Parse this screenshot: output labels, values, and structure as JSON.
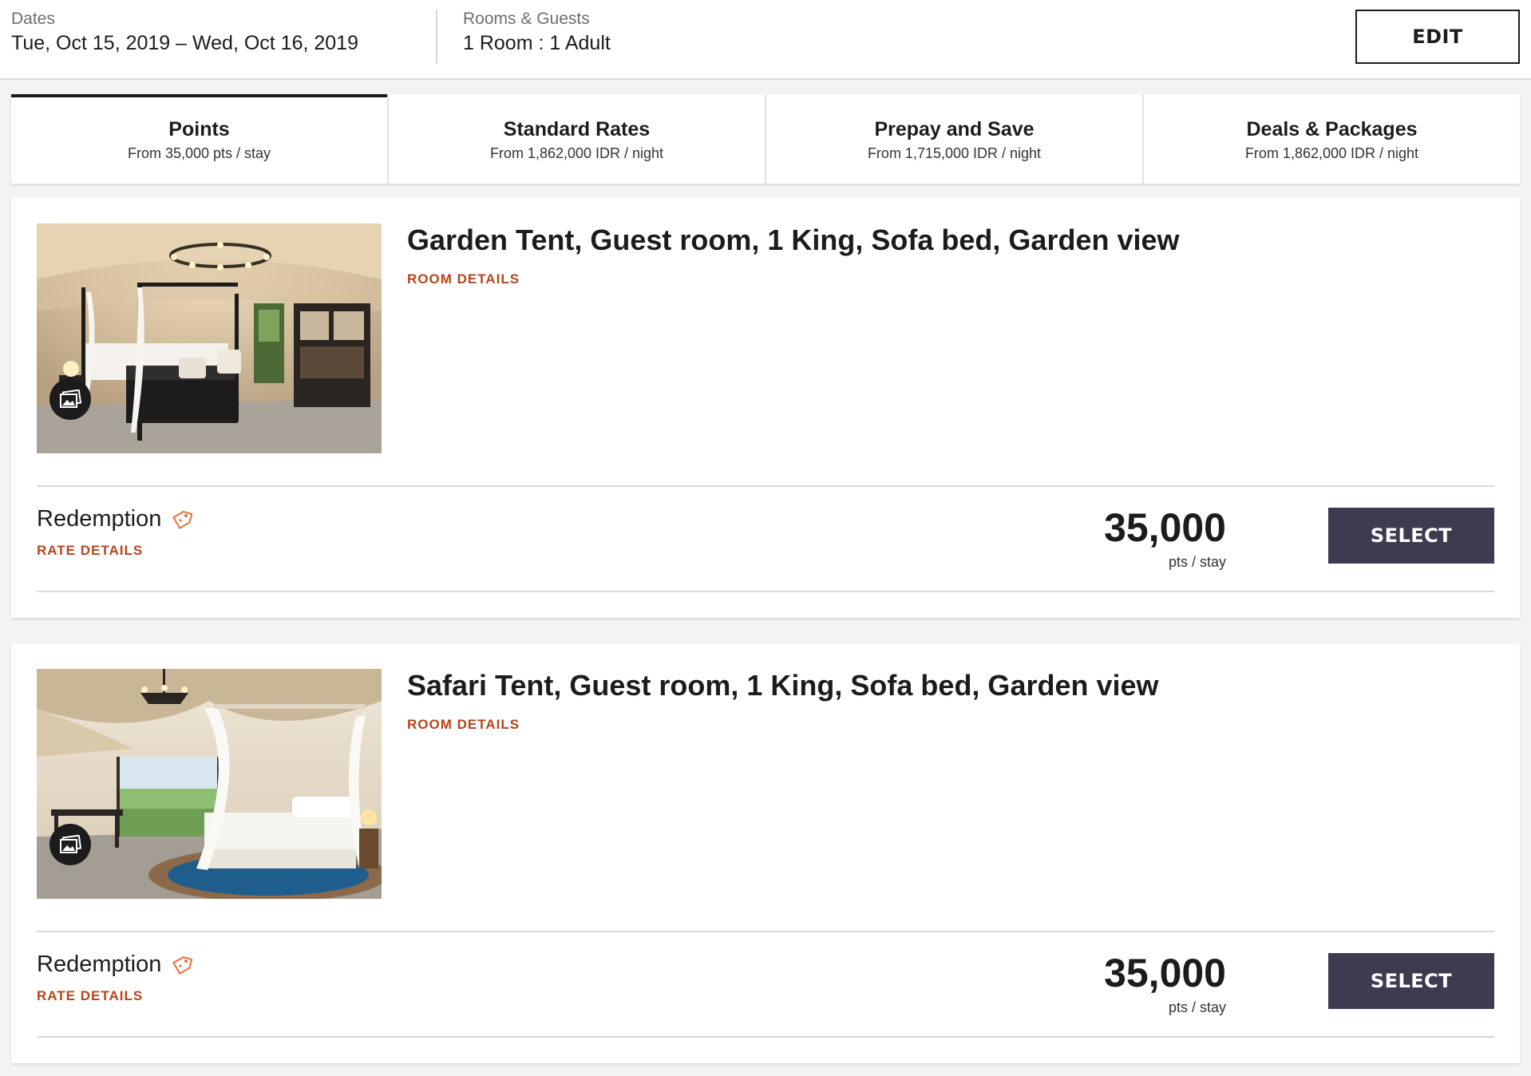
{
  "search_summary": {
    "dates_label": "Dates",
    "dates_value": "Tue, Oct 15, 2019 – Wed, Oct 16, 2019",
    "rooms_label": "Rooms & Guests",
    "rooms_value": "1 Room : 1 Adult",
    "edit_label": "EDIT"
  },
  "rate_tabs": [
    {
      "title": "Points",
      "subtitle": "From 35,000 pts / stay",
      "active": true
    },
    {
      "title": "Standard Rates",
      "subtitle": "From 1,862,000 IDR / night",
      "active": false
    },
    {
      "title": "Prepay and Save",
      "subtitle": "From 1,715,000 IDR / night",
      "active": false
    },
    {
      "title": "Deals & Packages",
      "subtitle": "From 1,862,000 IDR / night",
      "active": false
    }
  ],
  "rooms": [
    {
      "title": "Garden Tent, Guest room, 1 King, Sofa bed, Garden view",
      "room_details_label": "ROOM DETAILS",
      "rate_name": "Redemption",
      "rate_details_label": "RATE DETAILS",
      "price": "35,000",
      "price_unit": "pts / stay",
      "select_label": "SELECT",
      "gallery_icon": "gallery-icon",
      "tag_icon": "tag-icon"
    },
    {
      "title": "Safari Tent, Guest room, 1 King, Sofa bed, Garden view",
      "room_details_label": "ROOM DETAILS",
      "rate_name": "Redemption",
      "rate_details_label": "RATE DETAILS",
      "price": "35,000",
      "price_unit": "pts / stay",
      "select_label": "SELECT",
      "gallery_icon": "gallery-icon",
      "tag_icon": "tag-icon"
    }
  ],
  "colors": {
    "accent_link": "#b5451b",
    "select_button": "#3d3b4f",
    "tag_icon": "#e8703a",
    "active_tab_indicator": "#1c1c1c"
  }
}
